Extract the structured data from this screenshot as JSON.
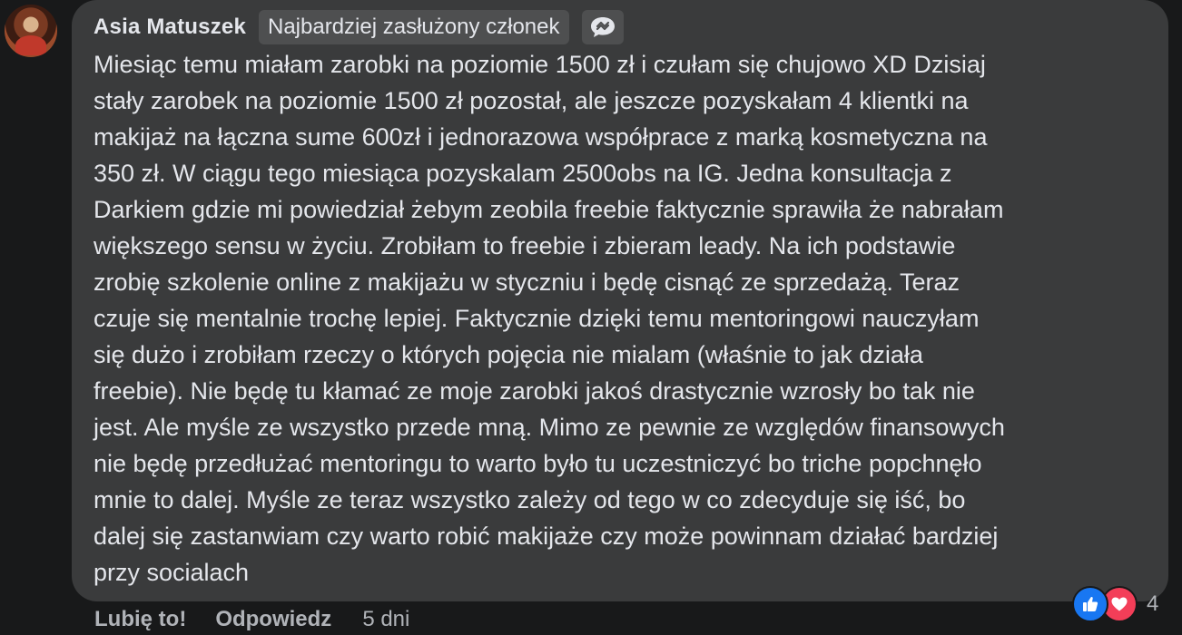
{
  "comment": {
    "author": "Asia Matuszek",
    "badge": "Najbardziej zasłużony członek",
    "badge_icon": "chat-bubble-icon",
    "text": "Miesiąc temu miałam zarobki na poziomie 1500 zł i czułam się chujowo XD Dzisiaj\nstały zarobek na poziomie 1500 zł pozostał, ale jeszcze pozyskałam 4 klientki na\nmakijaż na łączna sume 600zł i jednorazowa współprace z marką kosmetyczna na\n350 zł. W ciągu tego miesiąca pozyskalam 2500obs na IG. Jedna konsultacja z\nDarkiem gdzie mi powiedział żebym zeobila freebie faktycznie sprawiła że nabrałam\nwiększego sensu w życiu. Zrobiłam to freebie i zbieram leady. Na ich podstawie\nzrobię szkolenie online z makijażu w styczniu i będę cisnąć ze sprzedażą. Teraz\nczuje się mentalnie trochę lepiej. Faktycznie dzięki temu mentoringowi nauczyłam\nsię dużo i zrobiłam rzeczy o których pojęcia nie mialam (właśnie to jak działa\nfreebie). Nie będę tu kłamać ze moje zarobki jakoś drastycznie wzrosły bo tak nie\njest. Ale myśle ze wszystko przede mną. Mimo ze pewnie ze względów finansowych\nnie będę przedłużać mentoringu to warto było tu uczestniczyć bo triche popchnęło\nmnie to dalej. Myśle ze teraz wszystko zależy od tego w co zdecyduje się iść, bo\ndalej się zastanwiam czy warto robić makijaże czy może powinnam działać bardziej\nprzy socialach"
  },
  "actions": {
    "like_label": "Lubię to!",
    "reply_label": "Odpowiedz",
    "timestamp": "5 dni"
  },
  "reactions": {
    "icons": [
      "thumbs-up-icon",
      "heart-icon"
    ],
    "count": "4",
    "colors": {
      "like": "#1877f2",
      "love": "#f33e58"
    }
  }
}
